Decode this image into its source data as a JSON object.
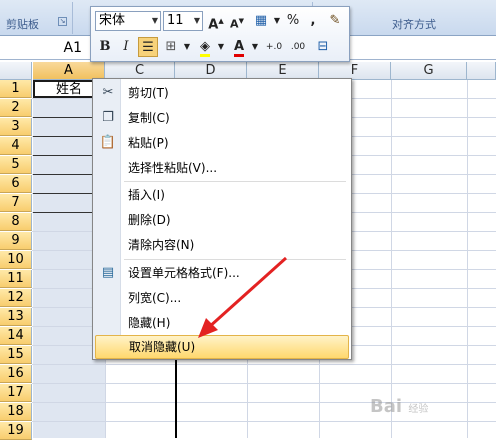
{
  "ribbon": {
    "clipboard_label": "剪贴板",
    "alignment_label": "对齐方式",
    "dialog_launcher": "⌄"
  },
  "formula_bar": {
    "name_box": "A1"
  },
  "grid": {
    "columns": [
      "A",
      "B",
      "C",
      "D",
      "E",
      "F",
      "G"
    ],
    "rows": [
      "1",
      "2",
      "3",
      "4",
      "5",
      "6",
      "7",
      "8",
      "9",
      "10",
      "11",
      "12",
      "13",
      "14",
      "15",
      "16",
      "17",
      "18",
      "19"
    ],
    "cell_a1": "姓名"
  },
  "mini_toolbar": {
    "font_name": "宋体",
    "font_size": "11",
    "grow_font": "A",
    "shrink_font": "A",
    "percent": "%",
    "comma": ",",
    "bold": "B",
    "italic": "I",
    "font_color": "A",
    "increase_decimal": "+.0",
    "decrease_decimal": ".00"
  },
  "context_menu": {
    "items": [
      {
        "label": "剪切(T)",
        "icon": "scissors-icon"
      },
      {
        "label": "复制(C)",
        "icon": "copy-icon"
      },
      {
        "label": "粘贴(P)",
        "icon": "paste-icon"
      },
      {
        "label": "选择性粘贴(V)...",
        "icon": ""
      },
      {
        "label": "插入(I)",
        "icon": ""
      },
      {
        "label": "删除(D)",
        "icon": ""
      },
      {
        "label": "清除内容(N)",
        "icon": ""
      },
      {
        "label": "设置单元格格式(F)...",
        "icon": "format-cells-icon"
      },
      {
        "label": "列宽(C)...",
        "icon": ""
      },
      {
        "label": "隐藏(H)",
        "icon": ""
      },
      {
        "label": "取消隐藏(U)",
        "icon": ""
      }
    ],
    "highlighted_item": "取消隐藏(U)"
  },
  "watermark": {
    "text": "Bai",
    "suffix": "经验"
  },
  "colors": {
    "annotation_arrow": "#e32222",
    "menu_highlight": "#ffd86e",
    "selected_header": "#f8cd6e"
  }
}
